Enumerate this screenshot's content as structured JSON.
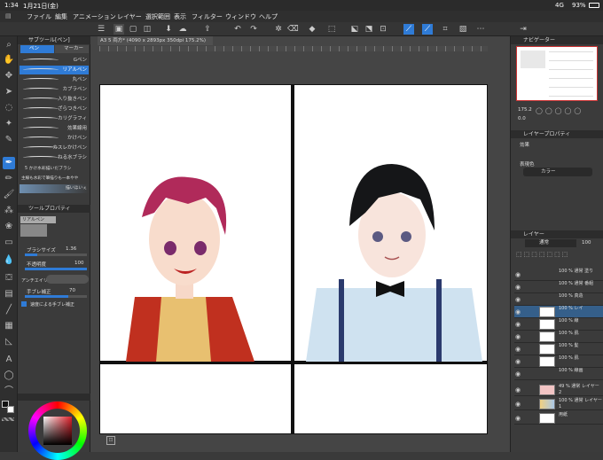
{
  "status": {
    "time": "1:34",
    "date": "1月21日(金)",
    "network": "4G",
    "battery": "93%"
  },
  "menu": [
    "ファイル",
    "編集",
    "アニメーション",
    "レイヤー",
    "選択範囲",
    "表示",
    "フィルター",
    "ウィンドウ",
    "ヘルプ"
  ],
  "subtool": {
    "title": "サブツール[ペン]",
    "tabs": [
      "ペン",
      "マーカー"
    ],
    "brushes": [
      "Gペン",
      "リアルペン",
      "丸ペン",
      "カブラペン",
      "入り抜きペン",
      "ざらつきペン",
      "カリグラフィ",
      "効果線用",
      "かけペン",
      "カスレかけペン",
      "ねる水ブラシ",
      "5 かけ水彩描いだブラシ",
      "主線も水彩で筆描りも一本やや",
      "描いほいぇ"
    ],
    "selected": "リアルペン"
  },
  "toolprop": {
    "title": "ツールプロパティ",
    "brush_name": "リアルペン",
    "size_label": "ブラシサイズ",
    "size_value": "1.36",
    "opacity_label": "不透明度",
    "opacity_value": "100",
    "aa_label": "アンチエイリ",
    "stab_label": "手ブレ補正",
    "stab_value": "70",
    "speed_label": "速度による手ブレ補正"
  },
  "document": {
    "tab": "A3  5 両方* (4090 x 2893px 350dpi 175.2%)"
  },
  "navigator": {
    "title": "ナビゲーター",
    "zoom": "175.2",
    "angle": "0.0"
  },
  "layerprop": {
    "title": "レイヤープロパティ",
    "effect": "効果",
    "expression_label": "表現色",
    "expression_value": "カラー"
  },
  "layers": {
    "title": "レイヤー",
    "blend": "通常",
    "opacity": "100",
    "items": [
      {
        "text": "100 % 通常 塗り"
      },
      {
        "text": "100 % 通常 番組"
      },
      {
        "text": "100 % 真造"
      },
      {
        "text": "100 % レイ"
      },
      {
        "text": "100 % 線"
      },
      {
        "text": "100 % 肌"
      },
      {
        "text": "100 % 髪"
      },
      {
        "text": "100 % 肌"
      },
      {
        "text": "100 % 線画"
      },
      {
        "text": "49 % 通常 レイヤー 2"
      },
      {
        "text": "100 % 通常 レイヤー 1"
      },
      {
        "text": "用紙"
      }
    ]
  },
  "colors": {
    "accent": "#2f7bd6",
    "bg": "#3a3a3a"
  }
}
